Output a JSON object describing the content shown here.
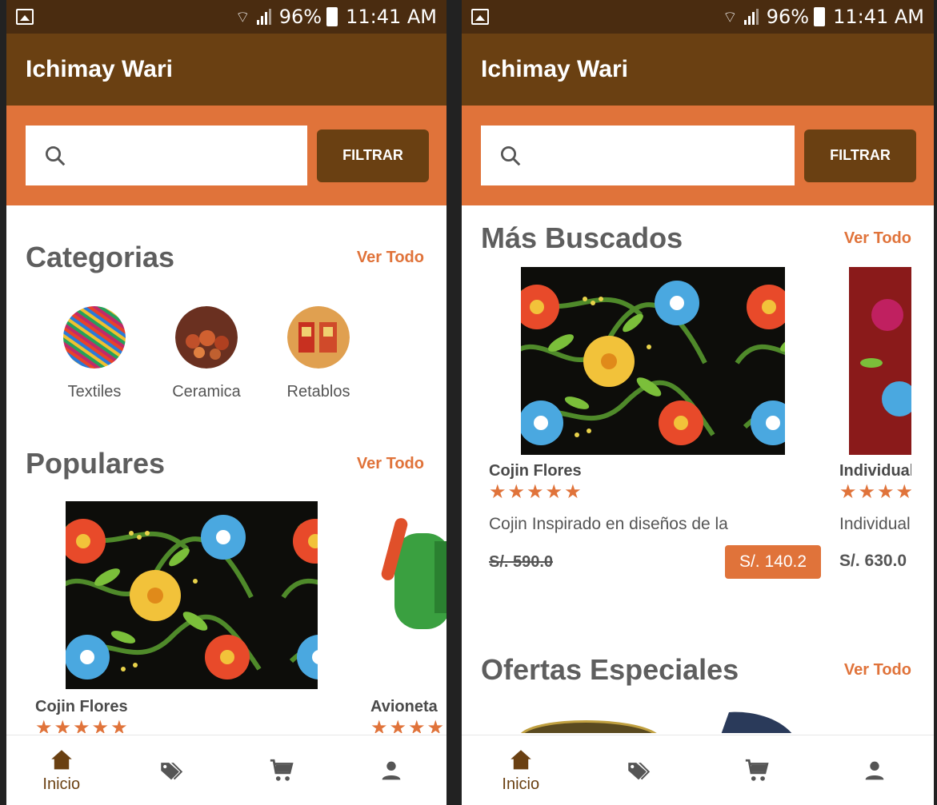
{
  "screens": [
    {
      "status": {
        "battery": "96%",
        "time": "11:41 AM"
      },
      "app_title": "Ichimay Wari",
      "search": {
        "placeholder": "",
        "filter_label": "FILTRAR"
      },
      "categorias": {
        "title": "Categorias",
        "ver_todo": "Ver Todo",
        "items": [
          {
            "label": "Textiles"
          },
          {
            "label": "Ceramica"
          },
          {
            "label": "Retablos"
          }
        ]
      },
      "populares": {
        "title": "Populares",
        "ver_todo": "Ver Todo",
        "products": [
          {
            "name": "Cojin Flores",
            "stars": "★★★★★"
          },
          {
            "name": "Avioneta",
            "stars": "★★★★"
          }
        ]
      },
      "nav": {
        "home_label": "Inicio"
      }
    },
    {
      "status": {
        "battery": "96%",
        "time": "11:41 AM"
      },
      "app_title": "Ichimay Wari",
      "search": {
        "placeholder": "",
        "filter_label": "FILTRAR"
      },
      "mas_buscados": {
        "title": "Más Buscados",
        "ver_todo": "Ver Todo",
        "products": [
          {
            "name": "Cojin Flores",
            "stars": "★★★★★",
            "description": "Cojin Inspirado en diseños de la",
            "old_price": "S/. 590.0",
            "price": "S/. 140.2"
          },
          {
            "name": "Individual",
            "stars": "★★★★",
            "description": "Individual",
            "price": "S/. 630.0"
          }
        ]
      },
      "ofertas": {
        "title": "Ofertas Especiales",
        "ver_todo": "Ver Todo"
      },
      "nav": {
        "home_label": "Inicio"
      }
    }
  ]
}
